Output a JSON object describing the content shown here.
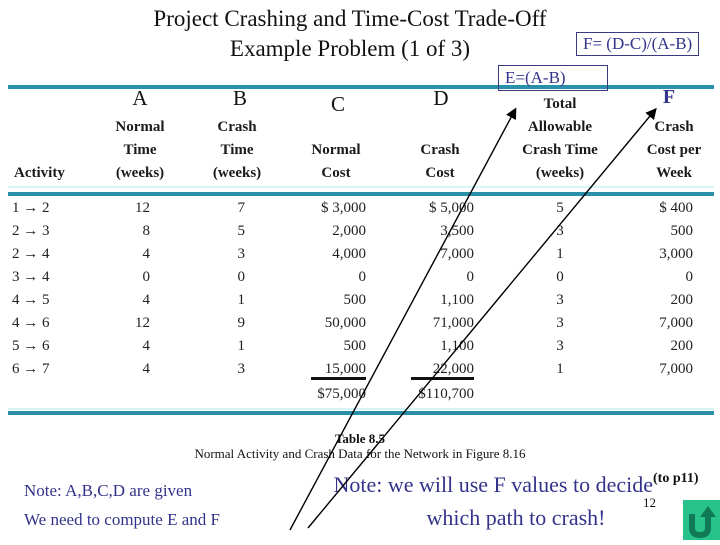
{
  "slide": {
    "title_line1": "Project Crashing and Time-Cost Trade-Off",
    "title_line2": "Example Problem (1 of 3)",
    "formula_f": "F= (D-C)/(A-B)",
    "formula_e": "E=(A-B)",
    "column_letters": [
      "A",
      "B",
      "C",
      "D",
      "F"
    ],
    "page_number": "12",
    "nav_link_label": "(to p11)"
  },
  "table": {
    "headers": {
      "activity": [
        "Activity"
      ],
      "normal_time": [
        "Normal",
        "Time",
        "(weeks)"
      ],
      "crash_time": [
        "Crash",
        "Time",
        "(weeks)"
      ],
      "normal_cost": [
        "Normal",
        "Cost"
      ],
      "crash_cost": [
        "Crash",
        "Cost"
      ],
      "allowable": [
        "Total",
        "Allowable",
        "Crash Time",
        "(weeks)"
      ],
      "cost_per_week": [
        "Crash",
        "Cost per",
        "Week"
      ]
    },
    "rows": [
      {
        "activity": "1 → 2",
        "normal_time": "12",
        "crash_time": "7",
        "normal_cost": "$ 3,000",
        "crash_cost": "$ 5,000",
        "allowable": "5",
        "cost_per_week": "$ 400"
      },
      {
        "activity": "2 → 3",
        "normal_time": "8",
        "crash_time": "5",
        "normal_cost": "2,000",
        "crash_cost": "3,500",
        "allowable": "3",
        "cost_per_week": "500"
      },
      {
        "activity": "2 → 4",
        "normal_time": "4",
        "crash_time": "3",
        "normal_cost": "4,000",
        "crash_cost": "7,000",
        "allowable": "1",
        "cost_per_week": "3,000"
      },
      {
        "activity": "3 → 4",
        "normal_time": "0",
        "crash_time": "0",
        "normal_cost": "0",
        "crash_cost": "0",
        "allowable": "0",
        "cost_per_week": "0"
      },
      {
        "activity": "4 → 5",
        "normal_time": "4",
        "crash_time": "1",
        "normal_cost": "500",
        "crash_cost": "1,100",
        "allowable": "3",
        "cost_per_week": "200"
      },
      {
        "activity": "4 → 6",
        "normal_time": "12",
        "crash_time": "9",
        "normal_cost": "50,000",
        "crash_cost": "71,000",
        "allowable": "3",
        "cost_per_week": "7,000"
      },
      {
        "activity": "5 → 6",
        "normal_time": "4",
        "crash_time": "1",
        "normal_cost": "500",
        "crash_cost": "1,100",
        "allowable": "3",
        "cost_per_week": "200"
      },
      {
        "activity": "6 → 7",
        "normal_time": "4",
        "crash_time": "3",
        "normal_cost": "15,000",
        "crash_cost": "22,000",
        "allowable": "1",
        "cost_per_week": "7,000"
      }
    ],
    "totals": {
      "normal_cost": "$75,000",
      "crash_cost": "$110,700"
    },
    "caption_title": "Table 8.5",
    "caption_subtitle": "Normal Activity and Crash Data for the Network in Figure 8.16"
  },
  "notes": {
    "left_line1": "Note: A,B,C,D are given",
    "left_line2": "We need to compute  E and F",
    "right_line1": "Note: we will use F values to decide",
    "right_line2": "which path to crash!"
  },
  "colors": {
    "accent_text": "#33338a",
    "rule": "#2a8fa8",
    "nav_button": "#27c38a"
  }
}
